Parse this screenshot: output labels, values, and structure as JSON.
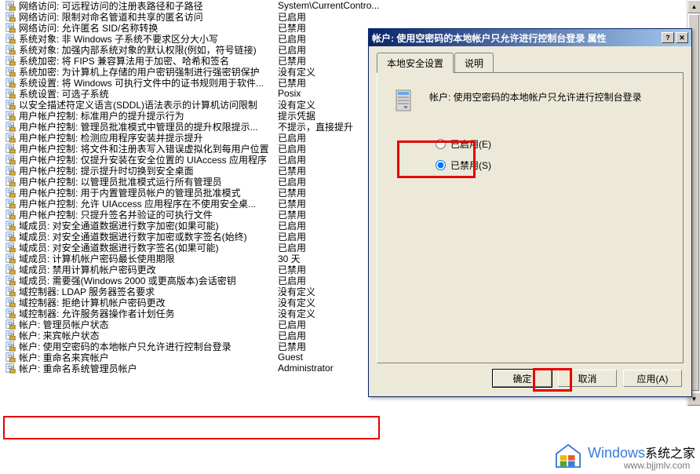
{
  "list": [
    {
      "name": "网络访问: 可远程访问的注册表路径和子路径",
      "value": "System\\CurrentContro..."
    },
    {
      "name": "网络访问: 限制对命名管道和共享的匿名访问",
      "value": "已启用"
    },
    {
      "name": "网络访问: 允许匿名 SID/名称转换",
      "value": "已禁用"
    },
    {
      "name": "系统对象: 非 Windows 子系统不要求区分大小写",
      "value": "已启用"
    },
    {
      "name": "系统对象: 加强内部系统对象的默认权限(例如，符号链接)",
      "value": "已启用"
    },
    {
      "name": "系统加密: 将 FIPS 兼容算法用于加密、哈希和签名",
      "value": "已禁用"
    },
    {
      "name": "系统加密: 为计算机上存储的用户密钥强制进行强密钥保护",
      "value": "没有定义"
    },
    {
      "name": "系统设置: 将 Windows 可执行文件中的证书规则用于软件...",
      "value": "已禁用"
    },
    {
      "name": "系统设置: 可选子系统",
      "value": "Posix"
    },
    {
      "name": "以安全描述符定义语言(SDDL)语法表示的计算机访问限制",
      "value": "没有定义"
    },
    {
      "name": "用户帐户控制: 标准用户的提升提示行为",
      "value": "提示凭据"
    },
    {
      "name": "用户帐户控制: 管理员批准模式中管理员的提升权限提示...",
      "value": "不提示，直接提升"
    },
    {
      "name": "用户帐户控制: 检测应用程序安装并提示提升",
      "value": "已启用"
    },
    {
      "name": "用户帐户控制: 将文件和注册表写入错误虚拟化到每用户位置",
      "value": "已启用"
    },
    {
      "name": "用户帐户控制: 仅提升安装在安全位置的 UIAccess 应用程序",
      "value": "已启用"
    },
    {
      "name": "用户帐户控制: 提示提升时切换到安全桌面",
      "value": "已禁用"
    },
    {
      "name": "用户帐户控制: 以管理员批准模式运行所有管理员",
      "value": "已启用"
    },
    {
      "name": "用户帐户控制: 用于内置管理员帐户的管理员批准模式",
      "value": "已禁用"
    },
    {
      "name": "用户帐户控制: 允许 UIAccess 应用程序在不使用安全桌...",
      "value": "已禁用"
    },
    {
      "name": "用户帐户控制: 只提升签名并验证的可执行文件",
      "value": "已禁用"
    },
    {
      "name": "域成员: 对安全通道数据进行数字加密(如果可能)",
      "value": "已启用"
    },
    {
      "name": "域成员: 对安全通道数据进行数字加密或数字签名(始终)",
      "value": "已启用"
    },
    {
      "name": "域成员: 对安全通道数据进行数字签名(如果可能)",
      "value": "已启用"
    },
    {
      "name": "域成员: 计算机帐户密码最长使用期限",
      "value": "30 天"
    },
    {
      "name": "域成员: 禁用计算机帐户密码更改",
      "value": "已禁用"
    },
    {
      "name": "域成员: 需要强(Windows 2000 或更高版本)会话密钥",
      "value": "已启用"
    },
    {
      "name": "域控制器: LDAP 服务器签名要求",
      "value": "没有定义"
    },
    {
      "name": "域控制器: 拒绝计算机帐户密码更改",
      "value": "没有定义"
    },
    {
      "name": "域控制器: 允许服务器操作者计划任务",
      "value": "没有定义"
    },
    {
      "name": "帐户: 管理员帐户状态",
      "value": "已启用"
    },
    {
      "name": "帐户: 来宾帐户状态",
      "value": "已启用"
    },
    {
      "name": "帐户: 使用空密码的本地帐户只允许进行控制台登录",
      "value": "已禁用"
    },
    {
      "name": "帐户: 重命名来宾帐户",
      "value": "Guest"
    },
    {
      "name": "帐户: 重命名系统管理员帐户",
      "value": "Administrator"
    }
  ],
  "dialog": {
    "title": "帐户: 使用空密码的本地帐户只允许进行控制台登录 属性",
    "tab_local": "本地安全设置",
    "tab_explain": "说明",
    "header": "帐户: 使用空密码的本地帐户只允许进行控制台登录",
    "radio_enabled": "已启用(E)",
    "radio_disabled": "已禁用(S)",
    "btn_ok": "确定",
    "btn_cancel": "取消",
    "btn_apply": "应用(A)"
  },
  "watermark": {
    "brand": "Windows",
    "suffix": "系统之家",
    "url": "www.bjjmlv.com"
  }
}
